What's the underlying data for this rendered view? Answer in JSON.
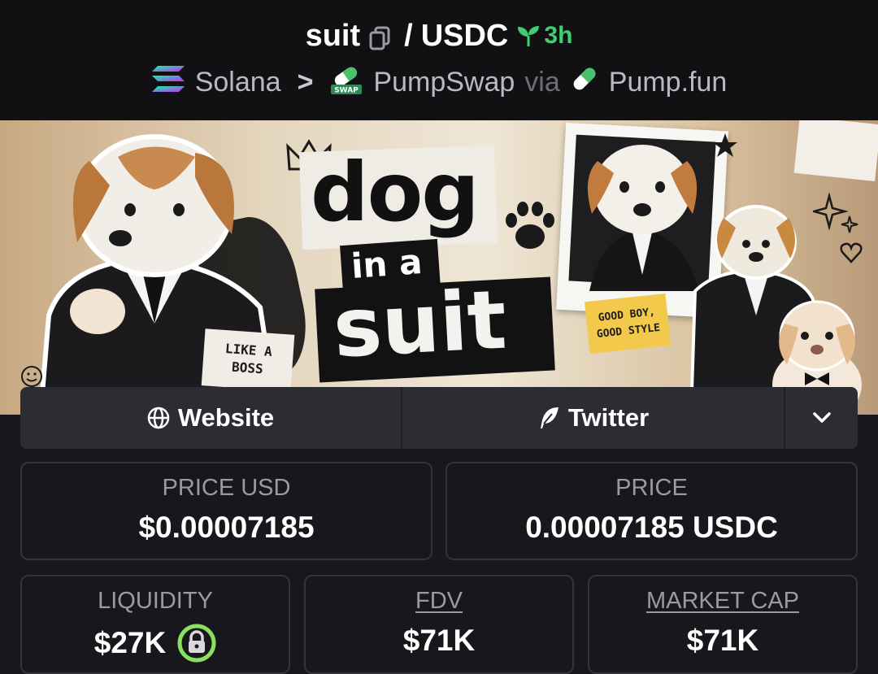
{
  "header": {
    "pair_base": "suit",
    "pair_sep": "/",
    "pair_quote": "USDC",
    "age": "3h",
    "chain": "Solana",
    "dex": "PumpSwap",
    "via_label": "via",
    "launchpad": "Pump.fun",
    "age_color": "#3fcf72"
  },
  "banner": {
    "words": [
      "dog",
      "in a",
      "suit"
    ],
    "sticker_left": [
      "LIKE A",
      "BOSS"
    ],
    "sticker_right": [
      "GOOD BOY,",
      "GOOD STYLE"
    ]
  },
  "links": {
    "website": "Website",
    "twitter": "Twitter"
  },
  "stats": {
    "price_usd_label": "PRICE USD",
    "price_usd": "$0.00007185",
    "price_label": "PRICE",
    "price": "0.00007185 USDC",
    "liquidity_label": "LIQUIDITY",
    "liquidity": "$27K",
    "fdv_label": "FDV",
    "fdv": "$71K",
    "mcap_label": "MARKET CAP",
    "mcap": "$71K"
  }
}
